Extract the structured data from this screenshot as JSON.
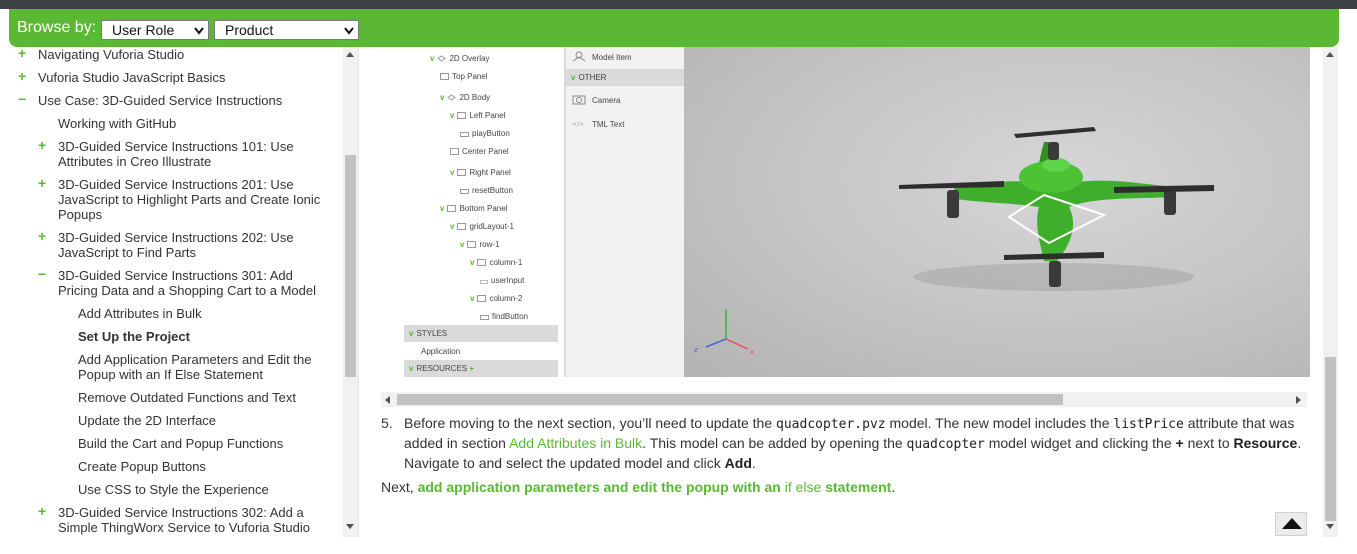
{
  "browse": {
    "label": "Browse by:",
    "role_value": "User Role",
    "product_value": "Product"
  },
  "toc": {
    "items": [
      {
        "sign": "+",
        "label": "Navigating Vuforia Studio"
      },
      {
        "sign": "+",
        "label": "Vuforia Studio JavaScript Basics"
      },
      {
        "sign": "−",
        "label": "Use Case: 3D-Guided Service Instructions"
      },
      {
        "sign": "",
        "label": "Working with GitHub"
      },
      {
        "sign": "+",
        "label": "3D-Guided Service Instructions 101: Use Attributes in Creo Illustrate"
      },
      {
        "sign": "+",
        "label": "3D-Guided Service Instructions 201: Use JavaScript to Highlight Parts and Create Ionic Popups"
      },
      {
        "sign": "+",
        "label": "3D-Guided Service Instructions 202: Use JavaScript to Find Parts"
      },
      {
        "sign": "−",
        "label": "3D-Guided Service Instructions 301: Add Pricing Data and a Shopping Cart to a Model"
      },
      {
        "sign": "",
        "label": "Add Attributes in Bulk"
      },
      {
        "sign": "",
        "label": "Set Up the Project"
      },
      {
        "sign": "",
        "label": "Add Application Parameters and Edit the Popup with an If Else Statement"
      },
      {
        "sign": "",
        "label": "Remove Outdated Functions and Text"
      },
      {
        "sign": "",
        "label": "Update the 2D Interface"
      },
      {
        "sign": "",
        "label": "Build the Cart and Popup Functions"
      },
      {
        "sign": "",
        "label": "Create Popup Buttons"
      },
      {
        "sign": "",
        "label": "Use CSS to Style the Experience"
      },
      {
        "sign": "+",
        "label": "3D-Guided Service Instructions 302: Add a Simple ThingWorx Service to Vuforia Studio"
      }
    ]
  },
  "figure": {
    "tree": [
      "2D Overlay",
      "Top Panel",
      "2D Body",
      "Left Panel",
      "playButton",
      "Center Panel",
      "Right Panel",
      "resetButton",
      "Bottom Panel",
      "gridLayout-1",
      "row-1",
      "column-1",
      "userInput",
      "column-2",
      "findButton"
    ],
    "styles_label": "STYLES",
    "application_label": "Application",
    "resources_label": "RESOURCES",
    "palette": {
      "model_item": "Model Item",
      "other_label": "OTHER",
      "camera": "Camera",
      "tml_text": "TML Text"
    },
    "axes": {
      "x": "x",
      "y": "y",
      "z": "z"
    },
    "colors": {
      "drone": "#3fae2a",
      "axis_x": "#e05050",
      "axis_y": "#3cb043",
      "axis_z": "#4a62d8"
    }
  },
  "step": {
    "number": "5.",
    "t1": "Before moving to the next section, you’ll need to update the ",
    "c1": "quadcopter.pvz",
    "t2": " model. The new model includes the ",
    "c2": "listPrice",
    "t3": " attribute that was added in section ",
    "link": "Add Attributes in Bulk",
    "t4": ". This model can be added by opening the ",
    "c3": "quadcopter",
    "t5": " model widget and clicking the ",
    "plus": "+",
    "t6": " next to ",
    "resource": "Resource",
    "t7": ". Navigate to and select the updated model and click ",
    "add": "Add",
    "t8": "."
  },
  "next": {
    "lead": "Next, ",
    "l1": "add application parameters and edit the popup with an ",
    "l2": "if else",
    "l3": " statement",
    "end": "."
  },
  "accent": "#5bb834"
}
